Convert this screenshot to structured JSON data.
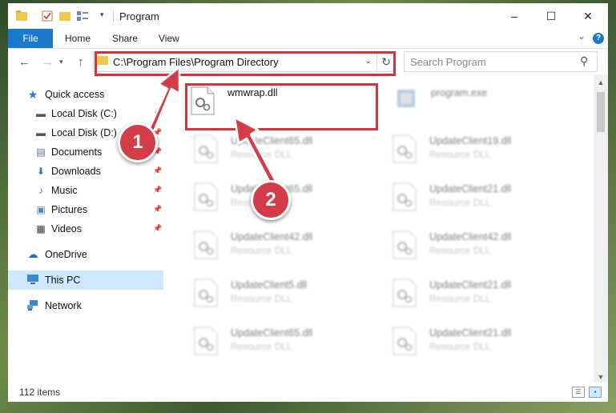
{
  "window": {
    "title": "Program",
    "controls": {
      "minimize": "–",
      "maximize": "☐",
      "close": "✕"
    }
  },
  "ribbon": {
    "tabs": [
      "File",
      "Home",
      "Share",
      "View"
    ],
    "help_label": "?",
    "expand_icon": "⌄"
  },
  "nav": {
    "back": "←",
    "forward": "→",
    "up": "↑",
    "address": "C:\\Program Files\\Program Directory",
    "address_chevron": "⌄",
    "refresh": "↻",
    "search_placeholder": "Search Program",
    "search_icon": "⚲"
  },
  "sidebar": {
    "quick_access": "Quick access",
    "items": [
      {
        "label": "Local Disk (C:)",
        "icon": "drive-icon",
        "glyph": "▬",
        "color": "#555555"
      },
      {
        "label": "Local Disk (D:)",
        "icon": "drive-icon",
        "glyph": "▬",
        "color": "#555555"
      },
      {
        "label": "Documents",
        "icon": "documents-icon",
        "glyph": "▤",
        "color": "#4a6a9a"
      },
      {
        "label": "Downloads",
        "icon": "downloads-icon",
        "glyph": "⬇",
        "color": "#2a7ad0"
      },
      {
        "label": "Music",
        "icon": "music-icon",
        "glyph": "♪",
        "color": "#2a7ad0"
      },
      {
        "label": "Pictures",
        "icon": "pictures-icon",
        "glyph": "▣",
        "color": "#4a8ab0"
      },
      {
        "label": "Videos",
        "icon": "videos-icon",
        "glyph": "▦",
        "color": "#333333"
      }
    ],
    "onedrive": "OneDrive",
    "this_pc": "This PC",
    "network": "Network"
  },
  "files": {
    "highlighted": {
      "name": "wmwrap.dll"
    },
    "right_top": {
      "name": "program.exe"
    },
    "left_column": [
      {
        "name": "UpdateClient65.dll",
        "type": "Resource DLL"
      },
      {
        "name": "UpdateClient65.dll",
        "type": "Resource DLL"
      },
      {
        "name": "UpdateClient42.dll",
        "type": "Resource DLL"
      },
      {
        "name": "UpdateClient5.dll",
        "type": "Resource DLL"
      },
      {
        "name": "UpdateClient65.dll",
        "type": "Resource DLL"
      }
    ],
    "right_column": [
      {
        "name": "UpdateClient19.dll",
        "type": "Resource DLL"
      },
      {
        "name": "UpdateClient21.dll",
        "type": "Resource DLL"
      },
      {
        "name": "UpdateClient42.dll",
        "type": "Resource DLL"
      },
      {
        "name": "UpdateClient21.dll",
        "type": "Resource DLL"
      },
      {
        "name": "UpdateClient21.dll",
        "type": "Resource DLL"
      }
    ]
  },
  "status": {
    "count": "112 items"
  },
  "annotations": {
    "step1": "1",
    "step2": "2",
    "accent_color": "#d43c48",
    "selection_color": "#cde8ff",
    "file_tab_color": "#1979ca"
  }
}
